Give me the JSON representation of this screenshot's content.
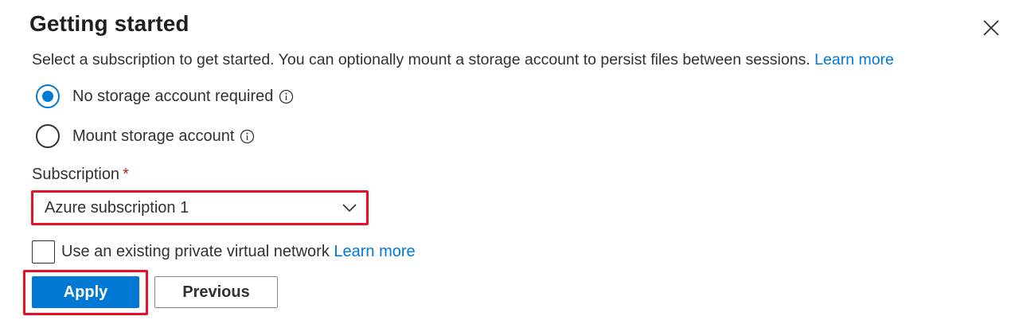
{
  "dialog": {
    "title": "Getting started",
    "description": "Select a subscription to get started. You can optionally mount a storage account to persist files between sessions.",
    "description_link": "Learn more"
  },
  "storage_options": [
    {
      "label": "No storage account required",
      "selected": true
    },
    {
      "label": "Mount storage account",
      "selected": false
    }
  ],
  "subscription": {
    "label": "Subscription",
    "required_marker": "*",
    "value": "Azure subscription 1"
  },
  "vnet": {
    "label": "Use an existing private virtual network",
    "link": "Learn more",
    "checked": false
  },
  "buttons": {
    "apply": "Apply",
    "previous": "Previous"
  },
  "colors": {
    "accent": "#0078d4",
    "highlight": "#e81123",
    "required": "#a4262c"
  },
  "icons": [
    "close-icon",
    "info-icon",
    "chevron-down-icon"
  ]
}
